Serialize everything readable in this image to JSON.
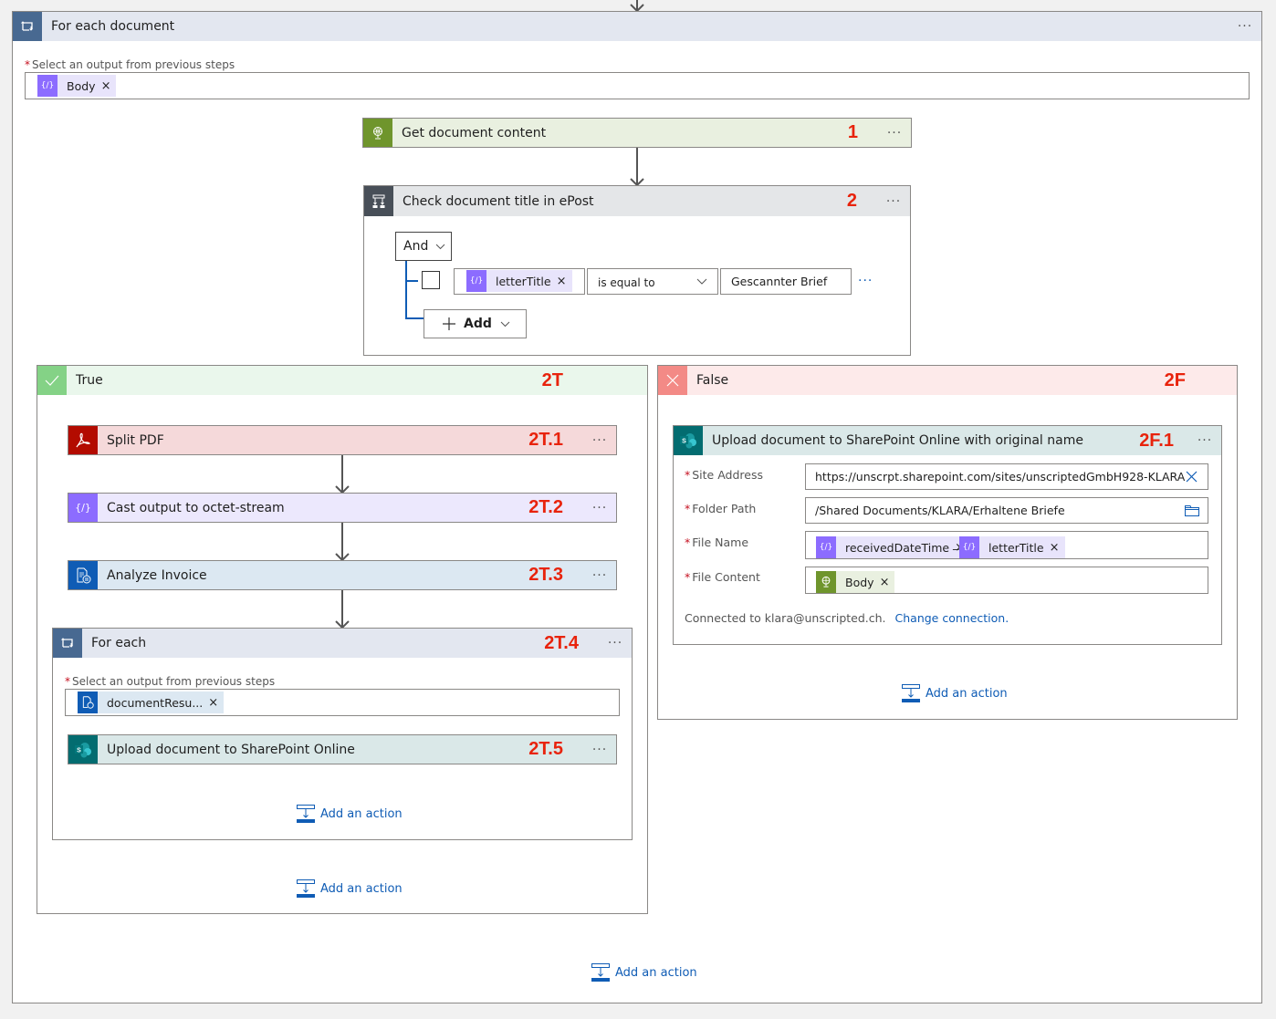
{
  "colors": {
    "accent_link": "#0f5cb5",
    "annotation_red": "#e8230c",
    "foreach_icon": "#486991",
    "http_icon": "#6f952c",
    "condition_icon": "#484f58",
    "variable_icon": "#8c6cff",
    "pdf_icon": "#b30b00",
    "form_recognizer_icon": "#0f5cb5",
    "sharepoint_icon": "#036c70",
    "true_icon": "#84d286",
    "false_icon": "#f38a86"
  },
  "outer_foreach": {
    "icon": "loop-icon",
    "title": "For each document",
    "more": "···",
    "select_label": "Select an output from previous steps",
    "token": {
      "icon": "variable-icon",
      "label": "Body",
      "remove": "×"
    }
  },
  "step1": {
    "icon": "globe-http-icon",
    "title": "Get document content",
    "number": "1",
    "more": "···"
  },
  "step2": {
    "icon": "condition-icon",
    "title": "Check document title in ePost",
    "number": "2",
    "more": "···",
    "group_operator": "And",
    "row": {
      "token": {
        "icon": "variable-icon",
        "label": "letterTitle",
        "remove": "×"
      },
      "operator": "is equal to",
      "value": "Gescannter Brief",
      "more": "···"
    },
    "add_label": "Add"
  },
  "true_branch": {
    "icon": "check-icon",
    "title": "True",
    "number": "2T",
    "steps": [
      {
        "icon": "pdf-icon",
        "title": "Split PDF",
        "number": "2T.1",
        "more": "···"
      },
      {
        "icon": "variable-icon",
        "title": "Cast output to octet-stream",
        "number": "2T.2",
        "more": "···"
      },
      {
        "icon": "form-recognizer-icon",
        "title": "Analyze Invoice",
        "number": "2T.3",
        "more": "···"
      }
    ],
    "foreach": {
      "icon": "loop-icon",
      "title": "For each",
      "number": "2T.4",
      "more": "···",
      "select_label": "Select an output from previous steps",
      "token": {
        "icon": "form-recognizer-icon",
        "label": "documentResu...",
        "remove": "×"
      },
      "inner_step": {
        "icon": "sharepoint-icon",
        "title": "Upload document to SharePoint Online",
        "number": "2T.5",
        "more": "···"
      },
      "add_action": "Add an action"
    },
    "add_action": "Add an action"
  },
  "false_branch": {
    "icon": "close-icon",
    "title": "False",
    "number": "2F",
    "step": {
      "icon": "sharepoint-icon",
      "title": "Upload document to SharePoint Online with original name",
      "number": "2F.1",
      "more": "···",
      "fields": {
        "site_address": {
          "label": "Site Address",
          "value": "https://unscrpt.sharepoint.com/sites/unscriptedGmbH928-KLARA"
        },
        "folder_path": {
          "label": "Folder Path",
          "value": "/Shared Documents/KLARA/Erhaltene Briefe"
        },
        "file_name": {
          "label": "File Name",
          "tokens": [
            {
              "icon": "variable-icon",
              "label": "receivedDateTime",
              "remove": "×"
            },
            {
              "icon": "variable-icon",
              "label": "letterTitle",
              "remove": "×"
            }
          ],
          "separator": "_"
        },
        "file_content": {
          "label": "File Content",
          "token": {
            "icon": "globe-http-icon",
            "label": "Body",
            "remove": "×"
          }
        }
      },
      "connection_text": "Connected to klara@unscripted.ch.",
      "change_connection": "Change connection."
    },
    "add_action": "Add an action"
  },
  "outer_add_action": "Add an action"
}
